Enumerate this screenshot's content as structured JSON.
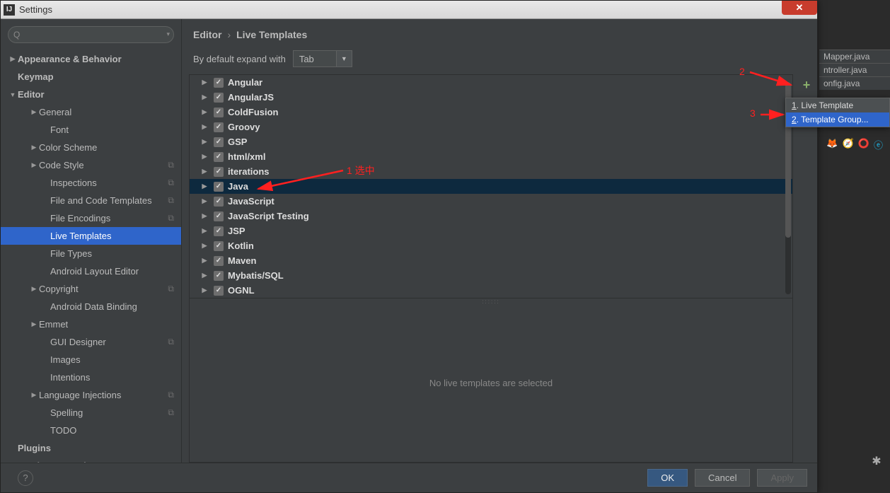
{
  "window": {
    "title": "Settings"
  },
  "background_tabs": [
    "Mapper.java",
    "ntroller.java",
    "onfig.java"
  ],
  "sidebar": {
    "search_placeholder": "",
    "nodes": [
      {
        "label": "Appearance & Behavior",
        "lvl": 0,
        "caret": "▶",
        "bold": true
      },
      {
        "label": "Keymap",
        "lvl": 0,
        "caret": "",
        "bold": true
      },
      {
        "label": "Editor",
        "lvl": 0,
        "caret": "▼",
        "bold": true
      },
      {
        "label": "General",
        "lvl": 1,
        "caret": "▶"
      },
      {
        "label": "Font",
        "lvl": 2,
        "caret": ""
      },
      {
        "label": "Color Scheme",
        "lvl": 1,
        "caret": "▶"
      },
      {
        "label": "Code Style",
        "lvl": 1,
        "caret": "▶",
        "cp": true
      },
      {
        "label": "Inspections",
        "lvl": 2,
        "caret": "",
        "cp": true
      },
      {
        "label": "File and Code Templates",
        "lvl": 2,
        "caret": "",
        "cp": true
      },
      {
        "label": "File Encodings",
        "lvl": 2,
        "caret": "",
        "cp": true
      },
      {
        "label": "Live Templates",
        "lvl": 2,
        "caret": "",
        "selected": true
      },
      {
        "label": "File Types",
        "lvl": 2,
        "caret": ""
      },
      {
        "label": "Android Layout Editor",
        "lvl": 2,
        "caret": ""
      },
      {
        "label": "Copyright",
        "lvl": 1,
        "caret": "▶",
        "cp": true
      },
      {
        "label": "Android Data Binding",
        "lvl": 2,
        "caret": ""
      },
      {
        "label": "Emmet",
        "lvl": 1,
        "caret": "▶"
      },
      {
        "label": "GUI Designer",
        "lvl": 2,
        "caret": "",
        "cp": true
      },
      {
        "label": "Images",
        "lvl": 2,
        "caret": ""
      },
      {
        "label": "Intentions",
        "lvl": 2,
        "caret": ""
      },
      {
        "label": "Language Injections",
        "lvl": 1,
        "caret": "▶",
        "cp": true
      },
      {
        "label": "Spelling",
        "lvl": 2,
        "caret": "",
        "cp": true
      },
      {
        "label": "TODO",
        "lvl": 2,
        "caret": ""
      },
      {
        "label": "Plugins",
        "lvl": 0,
        "caret": "",
        "bold": true
      },
      {
        "label": "Version Control",
        "lvl": 0,
        "caret": "▶",
        "bold": true
      }
    ]
  },
  "breadcrumb": {
    "a": "Editor",
    "b": "Live Templates"
  },
  "expand": {
    "label": "By default expand with",
    "value": "Tab"
  },
  "templates": [
    {
      "name": "Angular"
    },
    {
      "name": "AngularJS"
    },
    {
      "name": "ColdFusion"
    },
    {
      "name": "Groovy"
    },
    {
      "name": "GSP"
    },
    {
      "name": "html/xml"
    },
    {
      "name": "iterations"
    },
    {
      "name": "Java",
      "selected": true
    },
    {
      "name": "JavaScript"
    },
    {
      "name": "JavaScript Testing"
    },
    {
      "name": "JSP"
    },
    {
      "name": "Kotlin"
    },
    {
      "name": "Maven"
    },
    {
      "name": "Mybatis/SQL"
    },
    {
      "name": "OGNL"
    }
  ],
  "no_selection": "No live templates are selected",
  "popup": {
    "items": [
      {
        "key": "1",
        "label": "Live Template"
      },
      {
        "key": "2",
        "label": "Template Group...",
        "hl": true
      }
    ]
  },
  "buttons": {
    "ok": "OK",
    "cancel": "Cancel",
    "apply": "Apply"
  },
  "annotations": {
    "a1": "1  选中",
    "a2": "2",
    "a3": "3"
  }
}
